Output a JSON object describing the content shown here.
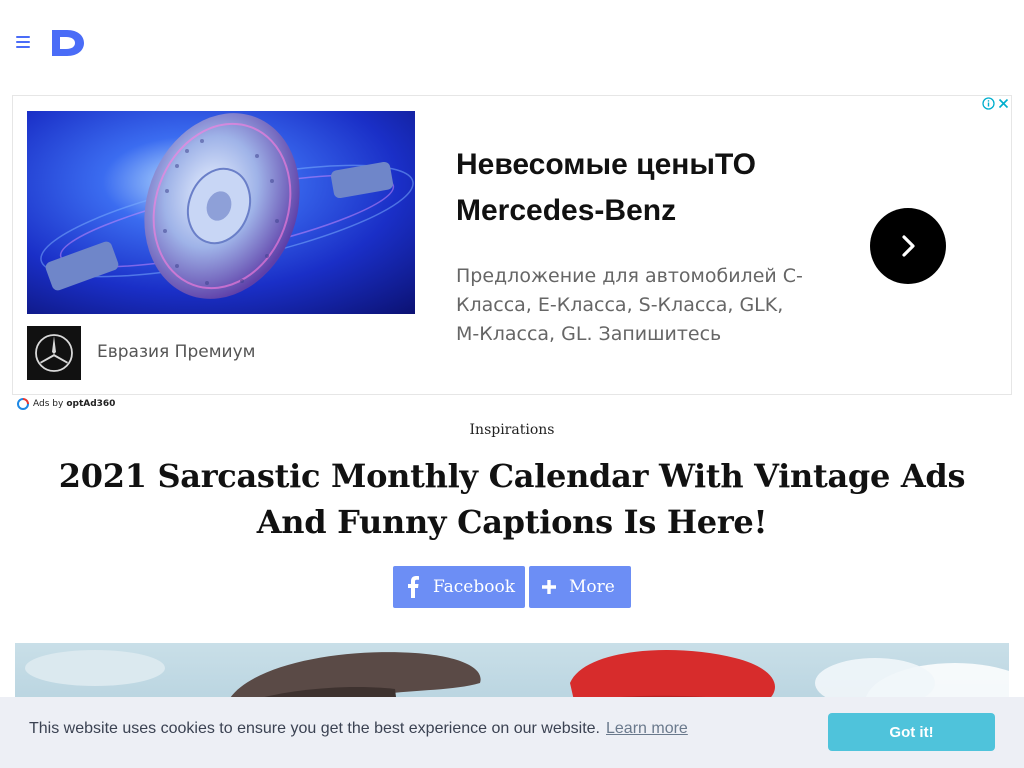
{
  "header": {
    "menu_icon": "hamburger-menu-icon",
    "logo_icon": "d-logo-icon",
    "brand_color": "#4a6cf7"
  },
  "ad": {
    "headline": "Невесомые ценыТО Mercedes-Benz",
    "description": "Предложение для автомобилей C-Класса, E-Класса, S-Класса, GLK, M-Класса, GL. Запишитесь",
    "brand_name": "Евразия Премиум",
    "image_icon": "brake-disc-image",
    "brand_logo_icon": "mercedes-star-icon",
    "arrow_icon": "chevron-right-icon",
    "info_icon": "info-icon",
    "close_icon": "close-icon",
    "ads_by_prefix": "Ads by",
    "ads_by_network": "optAd360"
  },
  "article": {
    "category": "Inspirations",
    "title": "2021 Sarcastic Monthly Calendar With Vintage Ads And Funny Captions Is Here!"
  },
  "share": {
    "facebook_label": "Facebook",
    "more_label": "More",
    "color": "#6c8ef5"
  },
  "cookie": {
    "message": "This website uses cookies to ensure you get the best experience on our website.",
    "learn_more": "Learn more",
    "button_label": "Got it!",
    "button_color": "#4fc3db"
  }
}
